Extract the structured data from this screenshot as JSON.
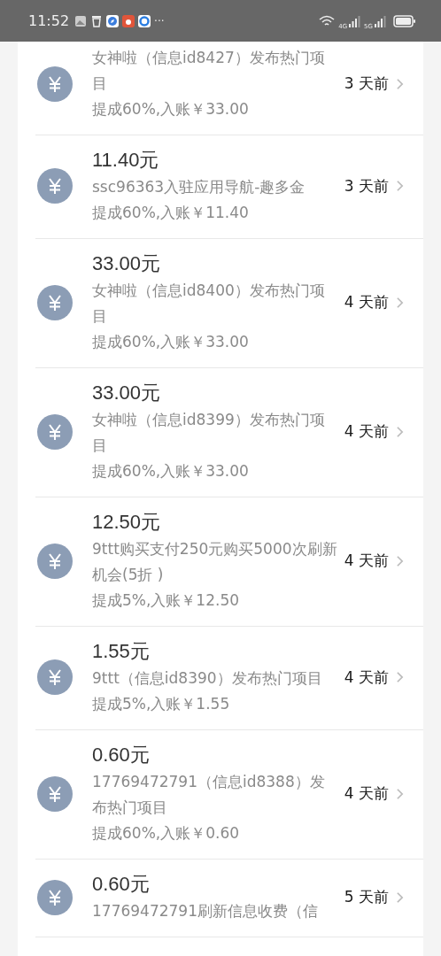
{
  "status_bar": {
    "time": "11:52",
    "more": "···",
    "signals": [
      "4G",
      "5G"
    ]
  },
  "records": [
    {
      "desc": "女神啦（信息id8427）发布热门项目",
      "commission": "提成60%,入账￥33.00",
      "time": "3 天前"
    },
    {
      "amount": "11.40元",
      "desc": "ssc96363入驻应用导航-趣多金",
      "commission": "提成60%,入账￥11.40",
      "time": "3 天前"
    },
    {
      "amount": "33.00元",
      "desc": "女神啦（信息id8400）发布热门项目",
      "commission": "提成60%,入账￥33.00",
      "time": "4 天前"
    },
    {
      "amount": "33.00元",
      "desc": "女神啦（信息id8399）发布热门项目",
      "commission": "提成60%,入账￥33.00",
      "time": "4 天前"
    },
    {
      "amount": "12.50元",
      "desc": "9ttt购买支付250元购买5000次刷新机会(5折 )",
      "commission": "提成5%,入账￥12.50",
      "time": "4 天前"
    },
    {
      "amount": "1.55元",
      "desc": "9ttt（信息id8390）发布热门项目",
      "commission": "提成5%,入账￥1.55",
      "time": "4 天前"
    },
    {
      "amount": "0.60元",
      "desc": "17769472791（信息id8388）发布热门项目",
      "commission": "提成60%,入账￥0.60",
      "time": "4 天前"
    },
    {
      "amount": "0.60元",
      "desc": "17769472791刷新信息收费（信",
      "time": "5 天前"
    }
  ]
}
